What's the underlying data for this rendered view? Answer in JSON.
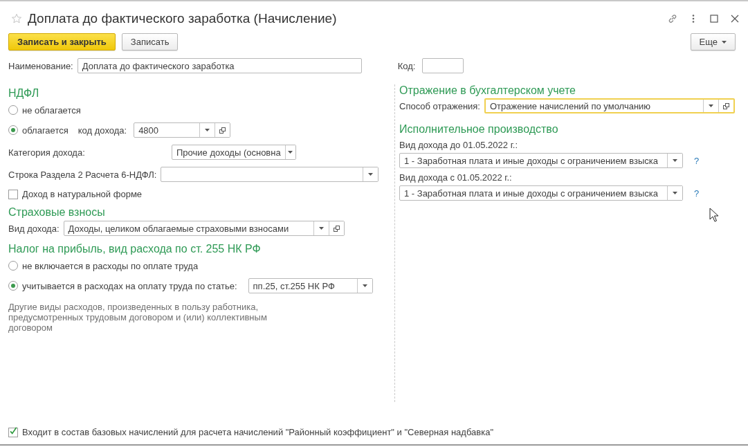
{
  "window": {
    "title": "Доплата до фактического заработка (Начисление)"
  },
  "toolbar": {
    "buttons": [
      {
        "label": "Записать и закрыть",
        "kind": "primary"
      },
      {
        "label": "Записать",
        "kind": "default"
      }
    ],
    "more_button": "Еще"
  },
  "name_field": {
    "label": "Наименование:",
    "value": "Доплата до фактического заработка"
  },
  "code_field": {
    "label": "Код:"
  },
  "ndfl": {
    "title": "НДФЛ",
    "options": [
      {
        "label": "не облагается",
        "selected": false
      },
      {
        "label": "облагается",
        "selected": true
      }
    ],
    "income_code": {
      "label": "код дохода:",
      "value": "4800"
    },
    "income_category": {
      "label": "Категория дохода:",
      "value": "Прочие доходы (основна"
    },
    "report_line": {
      "label": "Строка Раздела 2 Расчета 6-НДФЛ:"
    },
    "in_kind": {
      "label": "Доход в натуральной форме",
      "checked": false
    }
  },
  "insurance": {
    "title": "Страховые взносы",
    "income_type": {
      "label": "Вид дохода:",
      "value": "Доходы, целиком облагаемые страховыми взносами"
    }
  },
  "profit_tax": {
    "title": "Налог на прибыль, вид расхода по ст. 255 НК РФ",
    "options": [
      {
        "label": "не включается в расходы по оплате труда",
        "selected": false
      },
      {
        "label": "учитывается в расходах на оплату труда по статье:",
        "selected": true
      }
    ],
    "article": {
      "value": "пп.25, ст.255 НК РФ"
    },
    "note": "Другие виды расходов, произведенных в пользу работника, предусмотренных трудовым договором и (или) коллективным договором"
  },
  "accounting": {
    "title": "Отражение в бухгалтерском учете",
    "method": {
      "label": "Способ отражения:",
      "value": "Отражение начислений по умолчанию"
    }
  },
  "enforcement": {
    "title": "Исполнительное производство",
    "fields": [
      {
        "label": "Вид дохода до 01.05.2022 г.:",
        "value": "1 - Заработная плата и иные доходы с ограничением взыска",
        "help": "?"
      },
      {
        "label": "Вид дохода с 01.05.2022 г.:",
        "value": "1 - Заработная плата и иные доходы с ограничением взыска",
        "help": "?"
      }
    ]
  },
  "base_accruals": {
    "label": "Входит в состав базовых начислений для расчета начислений \"Районный коэффициент\" и \"Северная надбавка\"",
    "checked": true
  }
}
